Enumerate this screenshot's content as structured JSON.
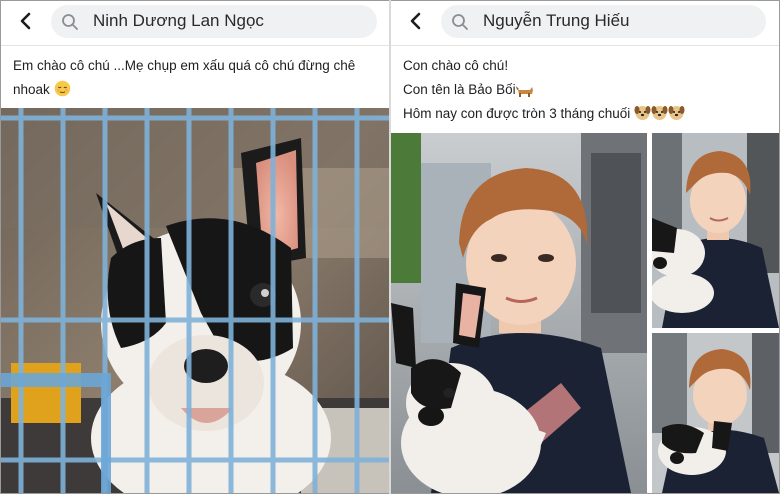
{
  "left_post": {
    "search_name": "Ninh Dương Lan Ngọc",
    "caption_text": "Em chào cô chú ...Mẹ chụp em xấu quá cô chú đừng chê nhoak",
    "caption_emoji": "relieved-face-emoji",
    "photo": "french-bulldog-puppy-in-cage"
  },
  "right_post": {
    "search_name": "Nguyễn Trung Hiếu",
    "caption_lines": [
      "Con chào cô chú!",
      "Con tên là Bảo Bối",
      "Hôm nay con được tròn 3 tháng chuối"
    ],
    "caption_emojis": [
      "dog-emoji",
      "dog-face-emoji",
      "dog-face-emoji",
      "dog-face-emoji"
    ],
    "photos": [
      "man-holding-french-bulldog-main",
      "man-holding-french-bulldog-thumb-1",
      "man-holding-french-bulldog-thumb-2"
    ]
  },
  "colors": {
    "search_bg": "#f0f1f3",
    "text": "#1c1e21",
    "border": "#9a9a9a",
    "hair": "#b06a3a"
  }
}
